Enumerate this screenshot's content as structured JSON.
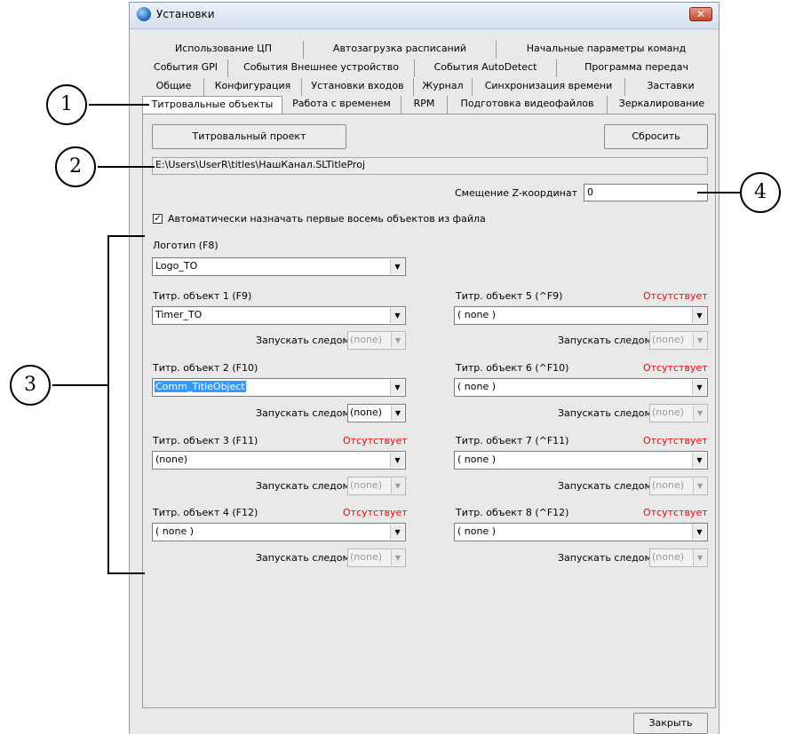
{
  "window": {
    "title": "Установки",
    "close_glyph": "✕"
  },
  "tabs": {
    "row1": [
      "Использование ЦП",
      "Автозагрузка расписаний",
      "Начальные параметры команд"
    ],
    "row2": [
      "События GPI",
      "События Внешнее устройство",
      "События AutoDetect",
      "Программа передач"
    ],
    "row3": [
      "Общие",
      "Конфигурация",
      "Установки входов",
      "Журнал",
      "Синхронизация времени",
      "Заставки"
    ],
    "row4": [
      "Титровальные объекты",
      "Работа с временем",
      "RPM",
      "Подготовка видеофайлов",
      "Зеркалирование"
    ]
  },
  "panel": {
    "project_button": "Титровальный проект",
    "reset_button": "Сбросить",
    "path": "E:\\Users\\UserR\\titles\\НашКанал.SLTitleProj",
    "z_offset_label": "Смещение Z-координат",
    "z_offset_value": "0",
    "auto_assign_label": "Автоматически назначать первые восемь объектов из файла",
    "auto_assign_checked": true,
    "logo_label": "Логотип (F8)",
    "logo_value": "Logo_TO",
    "launch_next_label": "Запускать следом",
    "missing_label": "Отсутствует",
    "objects": [
      {
        "label": "Титр. объект 1 (F9)",
        "value": "Timer_TO",
        "next": "(none)",
        "missing": false
      },
      {
        "label": "Титр. объект 2 (F10)",
        "value": "Comm_TitleObject",
        "next": "(none)",
        "missing": false
      },
      {
        "label": "Титр. объект 3 (F11)",
        "value": "(none)",
        "next": "(none)",
        "missing": true
      },
      {
        "label": "Титр. объект 4 (F12)",
        "value": "( none )",
        "next": "(none)",
        "missing": true
      },
      {
        "label": "Титр. объект 5 (^F9)",
        "value": "( none )",
        "next": "(none)",
        "missing": true
      },
      {
        "label": "Титр. объект 6 (^F10)",
        "value": "( none )",
        "next": "(none)",
        "missing": true
      },
      {
        "label": "Титр. объект 7 (^F11)",
        "value": "( none )",
        "next": "(none)",
        "missing": true
      },
      {
        "label": "Титр. объект 8 (^F12)",
        "value": "( none )",
        "next": "(none)",
        "missing": true
      }
    ]
  },
  "close_button": "Закрыть",
  "callouts": [
    "1",
    "2",
    "3",
    "4"
  ],
  "colors": {
    "missing": "#ff0000",
    "selection": "#3399ff"
  }
}
